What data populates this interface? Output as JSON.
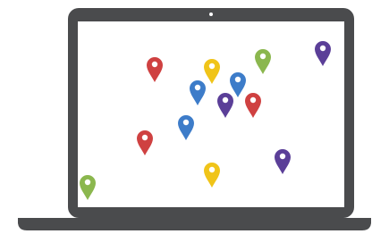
{
  "illustration": {
    "subject": "laptop-with-map-pins",
    "colors": {
      "laptop_body": "#4a4b4d",
      "laptop_base": "#4a4b4d",
      "screen": "#ffffff",
      "camera": "#ffffff",
      "pin_hole": "#ffffff"
    },
    "pins": [
      {
        "icon": "map-pin-icon",
        "color": "#cf4141"
      },
      {
        "icon": "map-pin-icon",
        "color": "#f0c419"
      },
      {
        "icon": "map-pin-icon",
        "color": "#8bb74e"
      },
      {
        "icon": "map-pin-icon",
        "color": "#5b3f98"
      },
      {
        "icon": "map-pin-icon",
        "color": "#3d7cc9"
      },
      {
        "icon": "map-pin-icon",
        "color": "#3d7cc9"
      },
      {
        "icon": "map-pin-icon",
        "color": "#5b3f98"
      },
      {
        "icon": "map-pin-icon",
        "color": "#cf4141"
      },
      {
        "icon": "map-pin-icon",
        "color": "#3d7cc9"
      },
      {
        "icon": "map-pin-icon",
        "color": "#cf4141"
      },
      {
        "icon": "map-pin-icon",
        "color": "#f0c419"
      },
      {
        "icon": "map-pin-icon",
        "color": "#5b3f98"
      },
      {
        "icon": "map-pin-icon",
        "color": "#8bb74e"
      }
    ]
  }
}
